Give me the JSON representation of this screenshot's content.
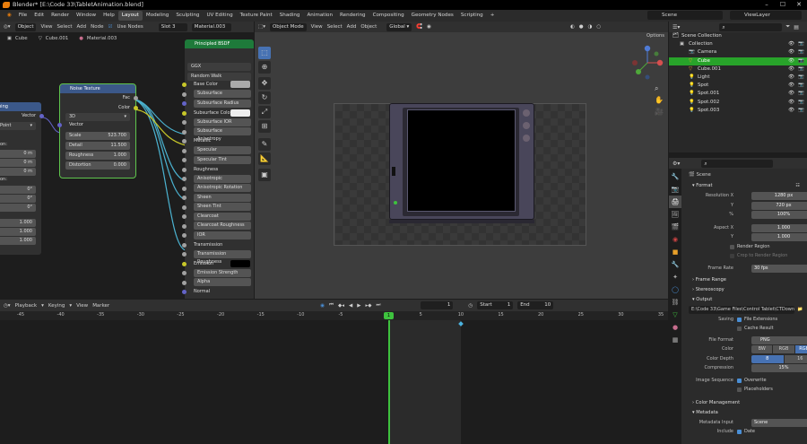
{
  "titlebar": {
    "title": "Blender* [E:\\Code 33\\TabletAnimation.blend]"
  },
  "menubar": {
    "items": [
      "File",
      "Edit",
      "Render",
      "Window",
      "Help"
    ],
    "workspaces": [
      "Layout",
      "Modeling",
      "Sculpting",
      "UV Editing",
      "Texture Paint",
      "Shading",
      "Animation",
      "Rendering",
      "Compositing",
      "Geometry Nodes",
      "Scripting"
    ],
    "active": "Layout",
    "add": "+",
    "scene": "Scene",
    "viewlayer": "ViewLayer"
  },
  "node_editor": {
    "header": {
      "mode": "Object",
      "view": "View",
      "select": "Select",
      "add": "Add",
      "node": "Node",
      "use_nodes": "Use Nodes",
      "slot": "Slot 3",
      "material": "Material.003"
    },
    "breadcrumb": {
      "object": "Cube",
      "mesh": "Cube.001",
      "material": "Material.003"
    },
    "mapping": {
      "title": "ping",
      "vector": "Vector",
      "type": "Point",
      "loc_label": "on:",
      "locs": [
        "0 m",
        "0 m",
        "0 m"
      ],
      "rot_label": "on:",
      "rots": [
        "0°",
        "0°",
        "0°"
      ],
      "scales": [
        "1.000",
        "1.000",
        "1.000"
      ]
    },
    "noise": {
      "title": "Noise Texture",
      "fac": "Fac",
      "color": "Color",
      "dim": "3D",
      "vector": "Vector",
      "fields": [
        {
          "l": "Scale",
          "v": "523.700"
        },
        {
          "l": "Detail",
          "v": "11.500"
        },
        {
          "l": "Roughness",
          "v": "1.000"
        },
        {
          "l": "Distortion",
          "v": "0.000"
        }
      ]
    },
    "bsdf": {
      "title": "Principled BSDF",
      "dist": "GGX",
      "sss": "Random Walk",
      "rows": [
        "Base Color",
        "Subsurface",
        "Subsurface Radius",
        "Subsurface Color",
        "Subsurface IOR",
        "Subsurface Anisotropy",
        "Metallic",
        "Specular",
        "Specular Tint",
        "Roughness",
        "Anisotropic",
        "Anisotropic Rotation",
        "Sheen",
        "Sheen Tint",
        "Clearcoat",
        "Clearcoat Roughness",
        "IOR",
        "Transmission",
        "Transmission Roughness",
        "Emission",
        "Emission Strength",
        "Alpha",
        "Normal"
      ]
    }
  },
  "viewport": {
    "header": {
      "mode": "Object Mode",
      "view": "View",
      "select": "Select",
      "add": "Add",
      "object": "Object",
      "orient": "Global",
      "options": "Options"
    }
  },
  "outliner": {
    "rows": [
      {
        "name": "Scene Collection"
      },
      {
        "name": "Collection"
      },
      {
        "name": "Camera"
      },
      {
        "name": "Cube"
      },
      {
        "name": "Cube.001"
      },
      {
        "name": "Light"
      },
      {
        "name": "Spot"
      },
      {
        "name": "Spot.001"
      },
      {
        "name": "Spot.002"
      },
      {
        "name": "Spot.003"
      }
    ]
  },
  "properties": {
    "scene": "Scene",
    "format": "Format",
    "res_x_l": "Resolution X",
    "res_x": "1280 px",
    "res_y_l": "Y",
    "res_y": "720 px",
    "pct_l": "%",
    "pct": "100%",
    "asp_x_l": "Aspect X",
    "asp_x": "1.000",
    "asp_y_l": "Y",
    "asp_y": "1.000",
    "render_region": "Render Region",
    "crop": "Crop to Render Region",
    "fps_l": "Frame Rate",
    "fps": "30 fps",
    "frame_range": "Frame Range",
    "stereo": "Stereoscopy",
    "output": "Output",
    "path": "E:\\Code 33\\Game Files\\Control Tablet\\CTDown\\",
    "saving_l": "Saving",
    "file_ext": "File Extensions",
    "cache": "Cache Result",
    "ff_l": "File Format",
    "ff": "PNG",
    "color_l": "Color",
    "bw": "BW",
    "rgb": "RGB",
    "rgba": "RGBA",
    "depth_l": "Color Depth",
    "d8": "8",
    "d16": "16",
    "comp_l": "Compression",
    "comp": "15%",
    "imgseq_l": "Image Sequence",
    "overwrite": "Overwrite",
    "placeholders": "Placeholders",
    "color_mgmt": "Color Management",
    "metadata": "Metadata",
    "meta_input_l": "Metadata Input",
    "meta_input": "Scene",
    "include": "Include",
    "date": "Date"
  },
  "timeline": {
    "header": {
      "playback": "Playback",
      "keying": "Keying",
      "view": "View",
      "marker": "Marker"
    },
    "current": "1",
    "start_l": "Start",
    "start": "1",
    "end_l": "End",
    "end": "10",
    "ruler": [
      "-45",
      "-40",
      "-35",
      "-30",
      "-25",
      "-20",
      "-15",
      "-10",
      "-5",
      "0",
      "5",
      "10",
      "15",
      "20",
      "25",
      "30",
      "35"
    ]
  }
}
